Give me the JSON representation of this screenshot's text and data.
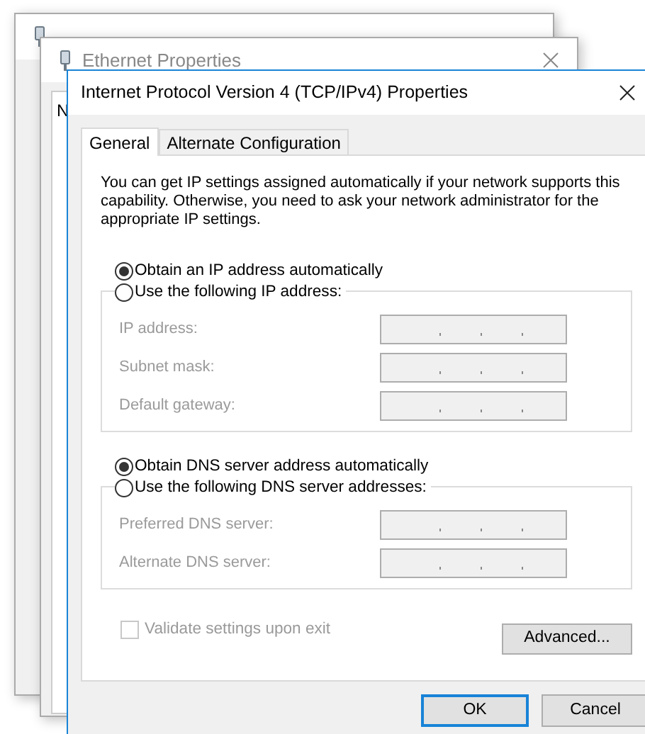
{
  "background_windows": [
    {
      "title": "Ethernet Properties",
      "tab_fragment": "N"
    }
  ],
  "dialog": {
    "title": "Internet Protocol Version 4 (TCP/IPv4) Properties"
  },
  "tabs": [
    {
      "label": "General",
      "selected": true
    },
    {
      "label": "Alternate Configuration",
      "selected": false
    }
  ],
  "description": "You can get IP settings assigned automatically if your network supports this capability. Otherwise, you need to ask your network administrator for the appropriate IP settings.",
  "groups": [
    {
      "auto_option": {
        "label": "Obtain an IP address automatically",
        "selected": true
      },
      "manual_option": {
        "label": "Use the following IP address:",
        "selected": false
      },
      "fields": [
        {
          "label": "IP address:",
          "disabled": true
        },
        {
          "label": "Subnet mask:",
          "disabled": true
        },
        {
          "label": "Default gateway:",
          "disabled": true
        }
      ]
    },
    {
      "auto_option": {
        "label": "Obtain DNS server address automatically",
        "selected": true
      },
      "manual_option": {
        "label": "Use the following DNS server addresses:",
        "selected": false
      },
      "fields": [
        {
          "label": "Preferred DNS server:",
          "disabled": true
        },
        {
          "label": "Alternate DNS server:",
          "disabled": true
        }
      ]
    }
  ],
  "validate": {
    "label": "Validate settings upon exit",
    "checked": false,
    "disabled": true
  },
  "advanced_button": "Advanced...",
  "buttons": [
    {
      "label": "OK",
      "default": true
    },
    {
      "label": "Cancel",
      "default": false
    }
  ]
}
